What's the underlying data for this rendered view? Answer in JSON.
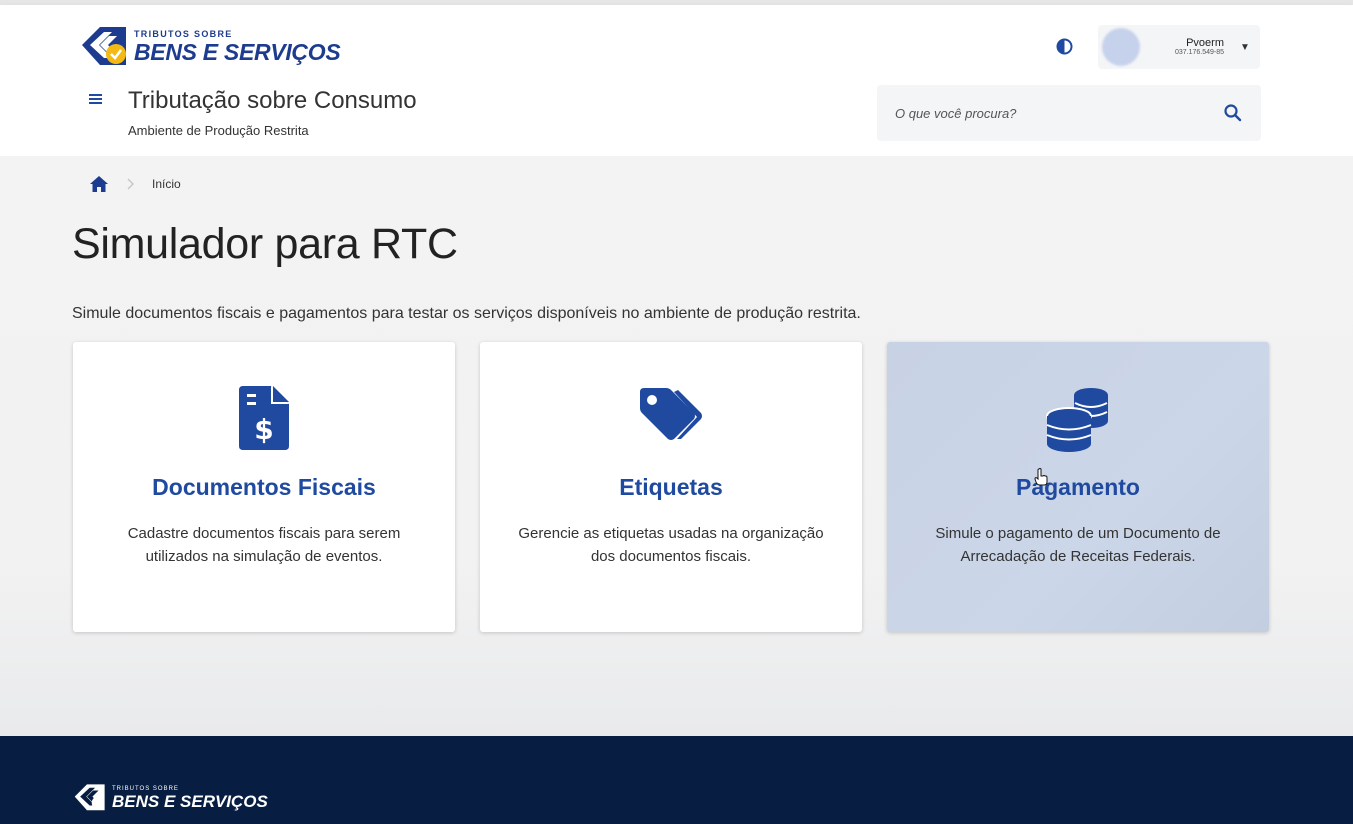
{
  "header": {
    "logo_small": "TRIBUTOS SOBRE",
    "logo_big": "BENS E SERVIÇOS",
    "app_title": "Tributação sobre Consumo",
    "app_subtitle": "Ambiente de Produção Restrita",
    "contrast_icon": "contrast-icon",
    "user": {
      "name": "Pvoerm",
      "cpf": "037.176.549-85"
    },
    "search": {
      "placeholder": "O que você procura?",
      "icon": "search-icon"
    },
    "menu_icon": "hamburger-icon"
  },
  "breadcrumb": {
    "home_icon": "home-icon",
    "current": "Início"
  },
  "page": {
    "title": "Simulador para RTC",
    "description": "Simule documentos fiscais e pagamentos para testar os serviços disponíveis no ambiente de produção restrita."
  },
  "cards": [
    {
      "icon": "file-invoice-dollar-icon",
      "title": "Documentos Fiscais",
      "text": "Cadastre documentos fiscais para serem utilizados na simulação de eventos."
    },
    {
      "icon": "tags-icon",
      "title": "Etiquetas",
      "text": "Gerencie as etiquetas usadas na organização dos documentos fiscais."
    },
    {
      "icon": "coins-icon",
      "title": "Pagamento",
      "text": "Simule o pagamento de um Documento de Arrecadação de Receitas Federais."
    }
  ],
  "footer": {
    "logo_small": "TRIBUTOS SOBRE",
    "logo_big": "BENS E SERVIÇOS"
  },
  "colors": {
    "primary": "#1f4aa0",
    "brand": "#1d3c8f",
    "accent": "#f5b914",
    "footer_bg": "#071d41",
    "card_hover": "#c9d4e6"
  }
}
